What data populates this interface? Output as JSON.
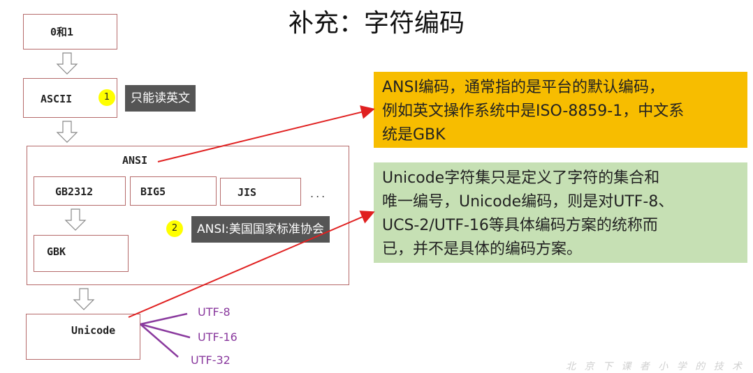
{
  "title": "补充：字符编码",
  "boxes": {
    "zero_one": "0和1",
    "ascii": "ASCII",
    "ansi": "ANSI",
    "gb2312": "GB2312",
    "big5": "BIG5",
    "jis": "JIS",
    "ellipsis": "...",
    "gbk": "GBK",
    "unicode": "Unicode"
  },
  "callouts": [
    {
      "badge": "1",
      "text": "只能读英文"
    },
    {
      "badge": "2",
      "text": "ANSI:美国国家标准协会"
    }
  ],
  "notes": {
    "ansi_note": [
      "ANSI编码，通常指的是平台的默认编码，",
      "例如英文操作系统中是ISO-8859-1，中文系",
      "统是GBK"
    ],
    "unicode_note": [
      "Unicode字符集只是定义了字符的集合和",
      "唯一编号，Unicode编码，则是对UTF-8、",
      "UCS-2/UTF-16等具体编码方案的统称而",
      "已，并不是具体的编码方案。"
    ]
  },
  "utf_labels": [
    "UTF-8",
    "UTF-16",
    "UTF-32"
  ],
  "watermark": "北 京 下 课 者 小 学 的 技 术",
  "colors": {
    "box_border": "#b56a6a",
    "arrow_red": "#e02020",
    "utf_purple": "#8a3a9e",
    "orange_note": "#f7bd00",
    "green_note": "#c6e0b4",
    "badge_yellow": "#ffff00",
    "tooltip_gray": "#555555"
  }
}
